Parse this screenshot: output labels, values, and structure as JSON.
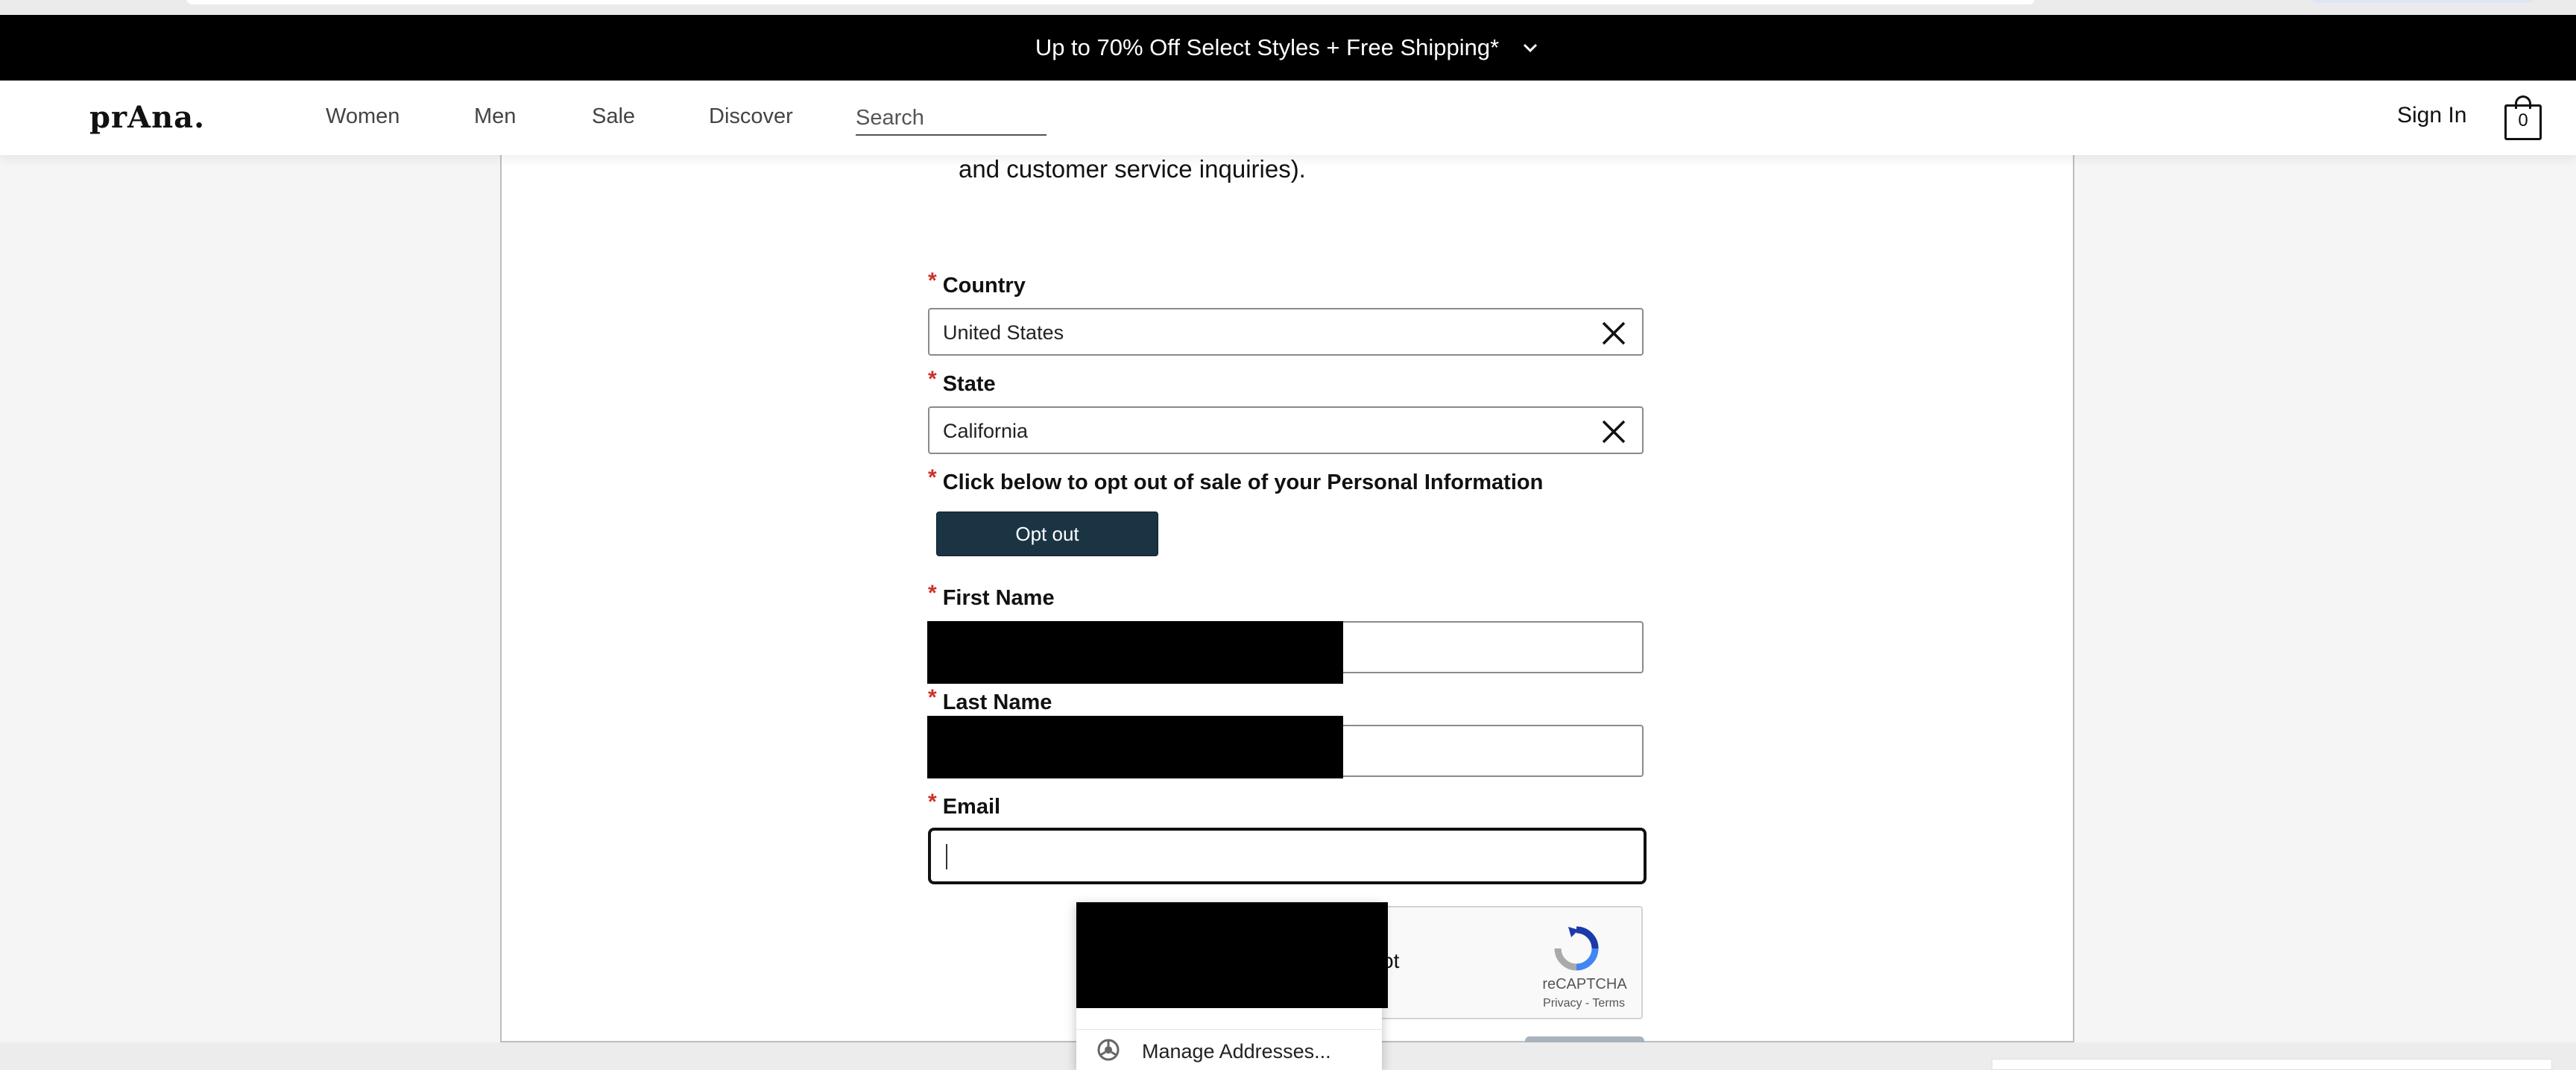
{
  "promo": {
    "text": "Up to 70% Off Select Styles + Free Shipping*"
  },
  "header": {
    "logo": "prAna.",
    "nav": [
      "Women",
      "Men",
      "Sale",
      "Discover"
    ],
    "search_placeholder": "Search",
    "sign_in": "Sign In",
    "cart_count": "0"
  },
  "form": {
    "intro_tail": "and customer service inquiries).",
    "required_mark": "*",
    "country": {
      "label": "Country",
      "value": "United States"
    },
    "state": {
      "label": "State",
      "value": "California"
    },
    "optout": {
      "label": "Click below to opt out of sale of your Personal Information",
      "button": "Opt out"
    },
    "first_name": {
      "label": "First Name"
    },
    "last_name": {
      "label": "Last Name"
    },
    "email": {
      "label": "Email"
    }
  },
  "recaptcha": {
    "partial_text": "ot",
    "brand": "reCAPTCHA",
    "links": "Privacy - Terms"
  },
  "autofill": {
    "manage_label": "Manage Addresses..."
  },
  "colors": {
    "promo_bg": "#000000",
    "button_bg": "#1b3444",
    "required": "#d0302b"
  }
}
